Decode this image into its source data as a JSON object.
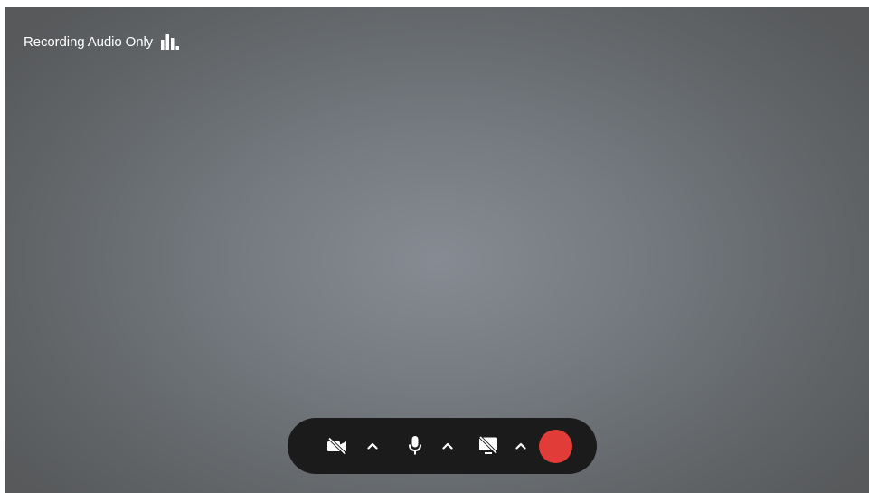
{
  "status": {
    "label": "Recording Audio Only",
    "icon": "audio-level-bars-icon"
  },
  "controls": {
    "camera": {
      "icon": "camera-off-icon",
      "state": "off"
    },
    "camera_options": {
      "icon": "chevron-up-icon"
    },
    "microphone": {
      "icon": "microphone-icon",
      "state": "on"
    },
    "microphone_options": {
      "icon": "chevron-up-icon"
    },
    "screen_share": {
      "icon": "screen-share-off-icon",
      "state": "off"
    },
    "screen_share_options": {
      "icon": "chevron-up-icon"
    },
    "record": {
      "icon": "record-button",
      "color": "#e13c38"
    }
  },
  "colors": {
    "control_bar": "#1b1b1c",
    "background_center": "#868b93",
    "background_edge": "#57595b",
    "icon": "#ffffff"
  }
}
